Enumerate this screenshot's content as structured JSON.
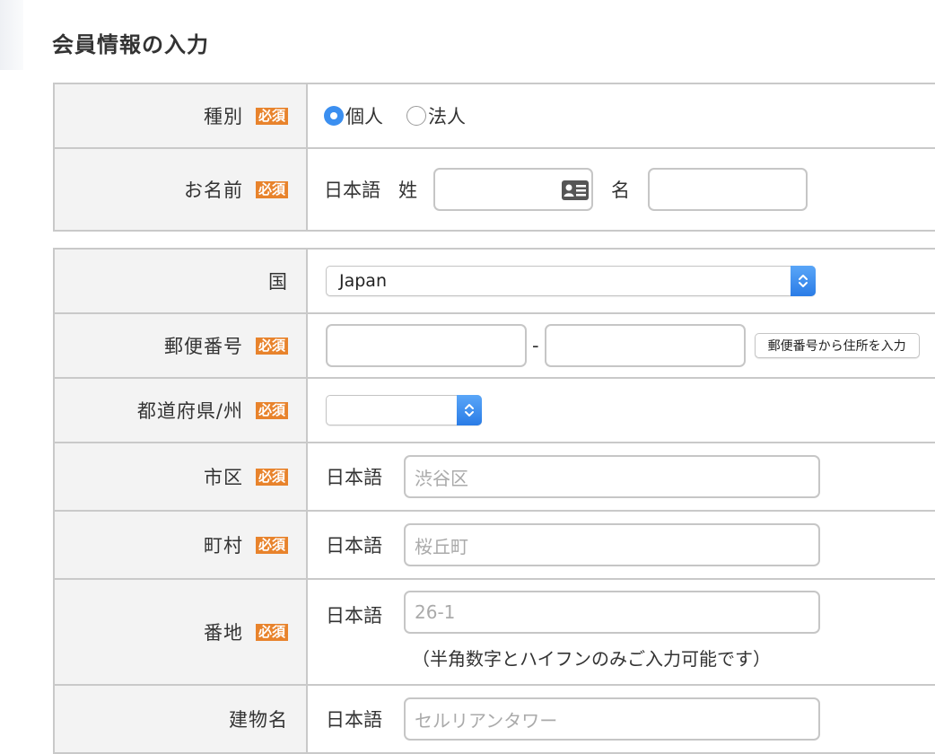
{
  "page_title": "会員情報の入力",
  "required_badge": "必須",
  "section1": {
    "type": {
      "label": "種別",
      "options": [
        {
          "label": "個人",
          "selected": true
        },
        {
          "label": "法人",
          "selected": false
        }
      ]
    },
    "name": {
      "label": "お名前",
      "language": "日本語",
      "last_name_label": "姓",
      "last_name_value": "",
      "first_name_label": "名",
      "first_name_value": ""
    }
  },
  "section2": {
    "country": {
      "label": "国",
      "selected": "Japan"
    },
    "postal_code": {
      "label": "郵便番号",
      "part1": "",
      "separator": "-",
      "part2": "",
      "lookup_button": "郵便番号から住所を入力"
    },
    "prefecture": {
      "label": "都道府県/州",
      "selected": ""
    },
    "city": {
      "label": "市区",
      "language": "日本語",
      "placeholder": "渋谷区",
      "value": ""
    },
    "town": {
      "label": "町村",
      "language": "日本語",
      "placeholder": "桜丘町",
      "value": ""
    },
    "address": {
      "label": "番地",
      "language": "日本語",
      "placeholder": "26-1",
      "value": "",
      "note": "（半角数字とハイフンのみご入力可能です）"
    },
    "building": {
      "label": "建物名",
      "language": "日本語",
      "placeholder": "セルリアンタワー",
      "value": ""
    }
  },
  "colors": {
    "required_badge": "#e8832c",
    "accent_blue": "#3b8ff0",
    "label_background": "#f3f3f3",
    "border": "#c9c9c9"
  },
  "icons": {
    "contact_card": "contact-card-icon",
    "select_arrows": "chevron-up-down-icon"
  }
}
